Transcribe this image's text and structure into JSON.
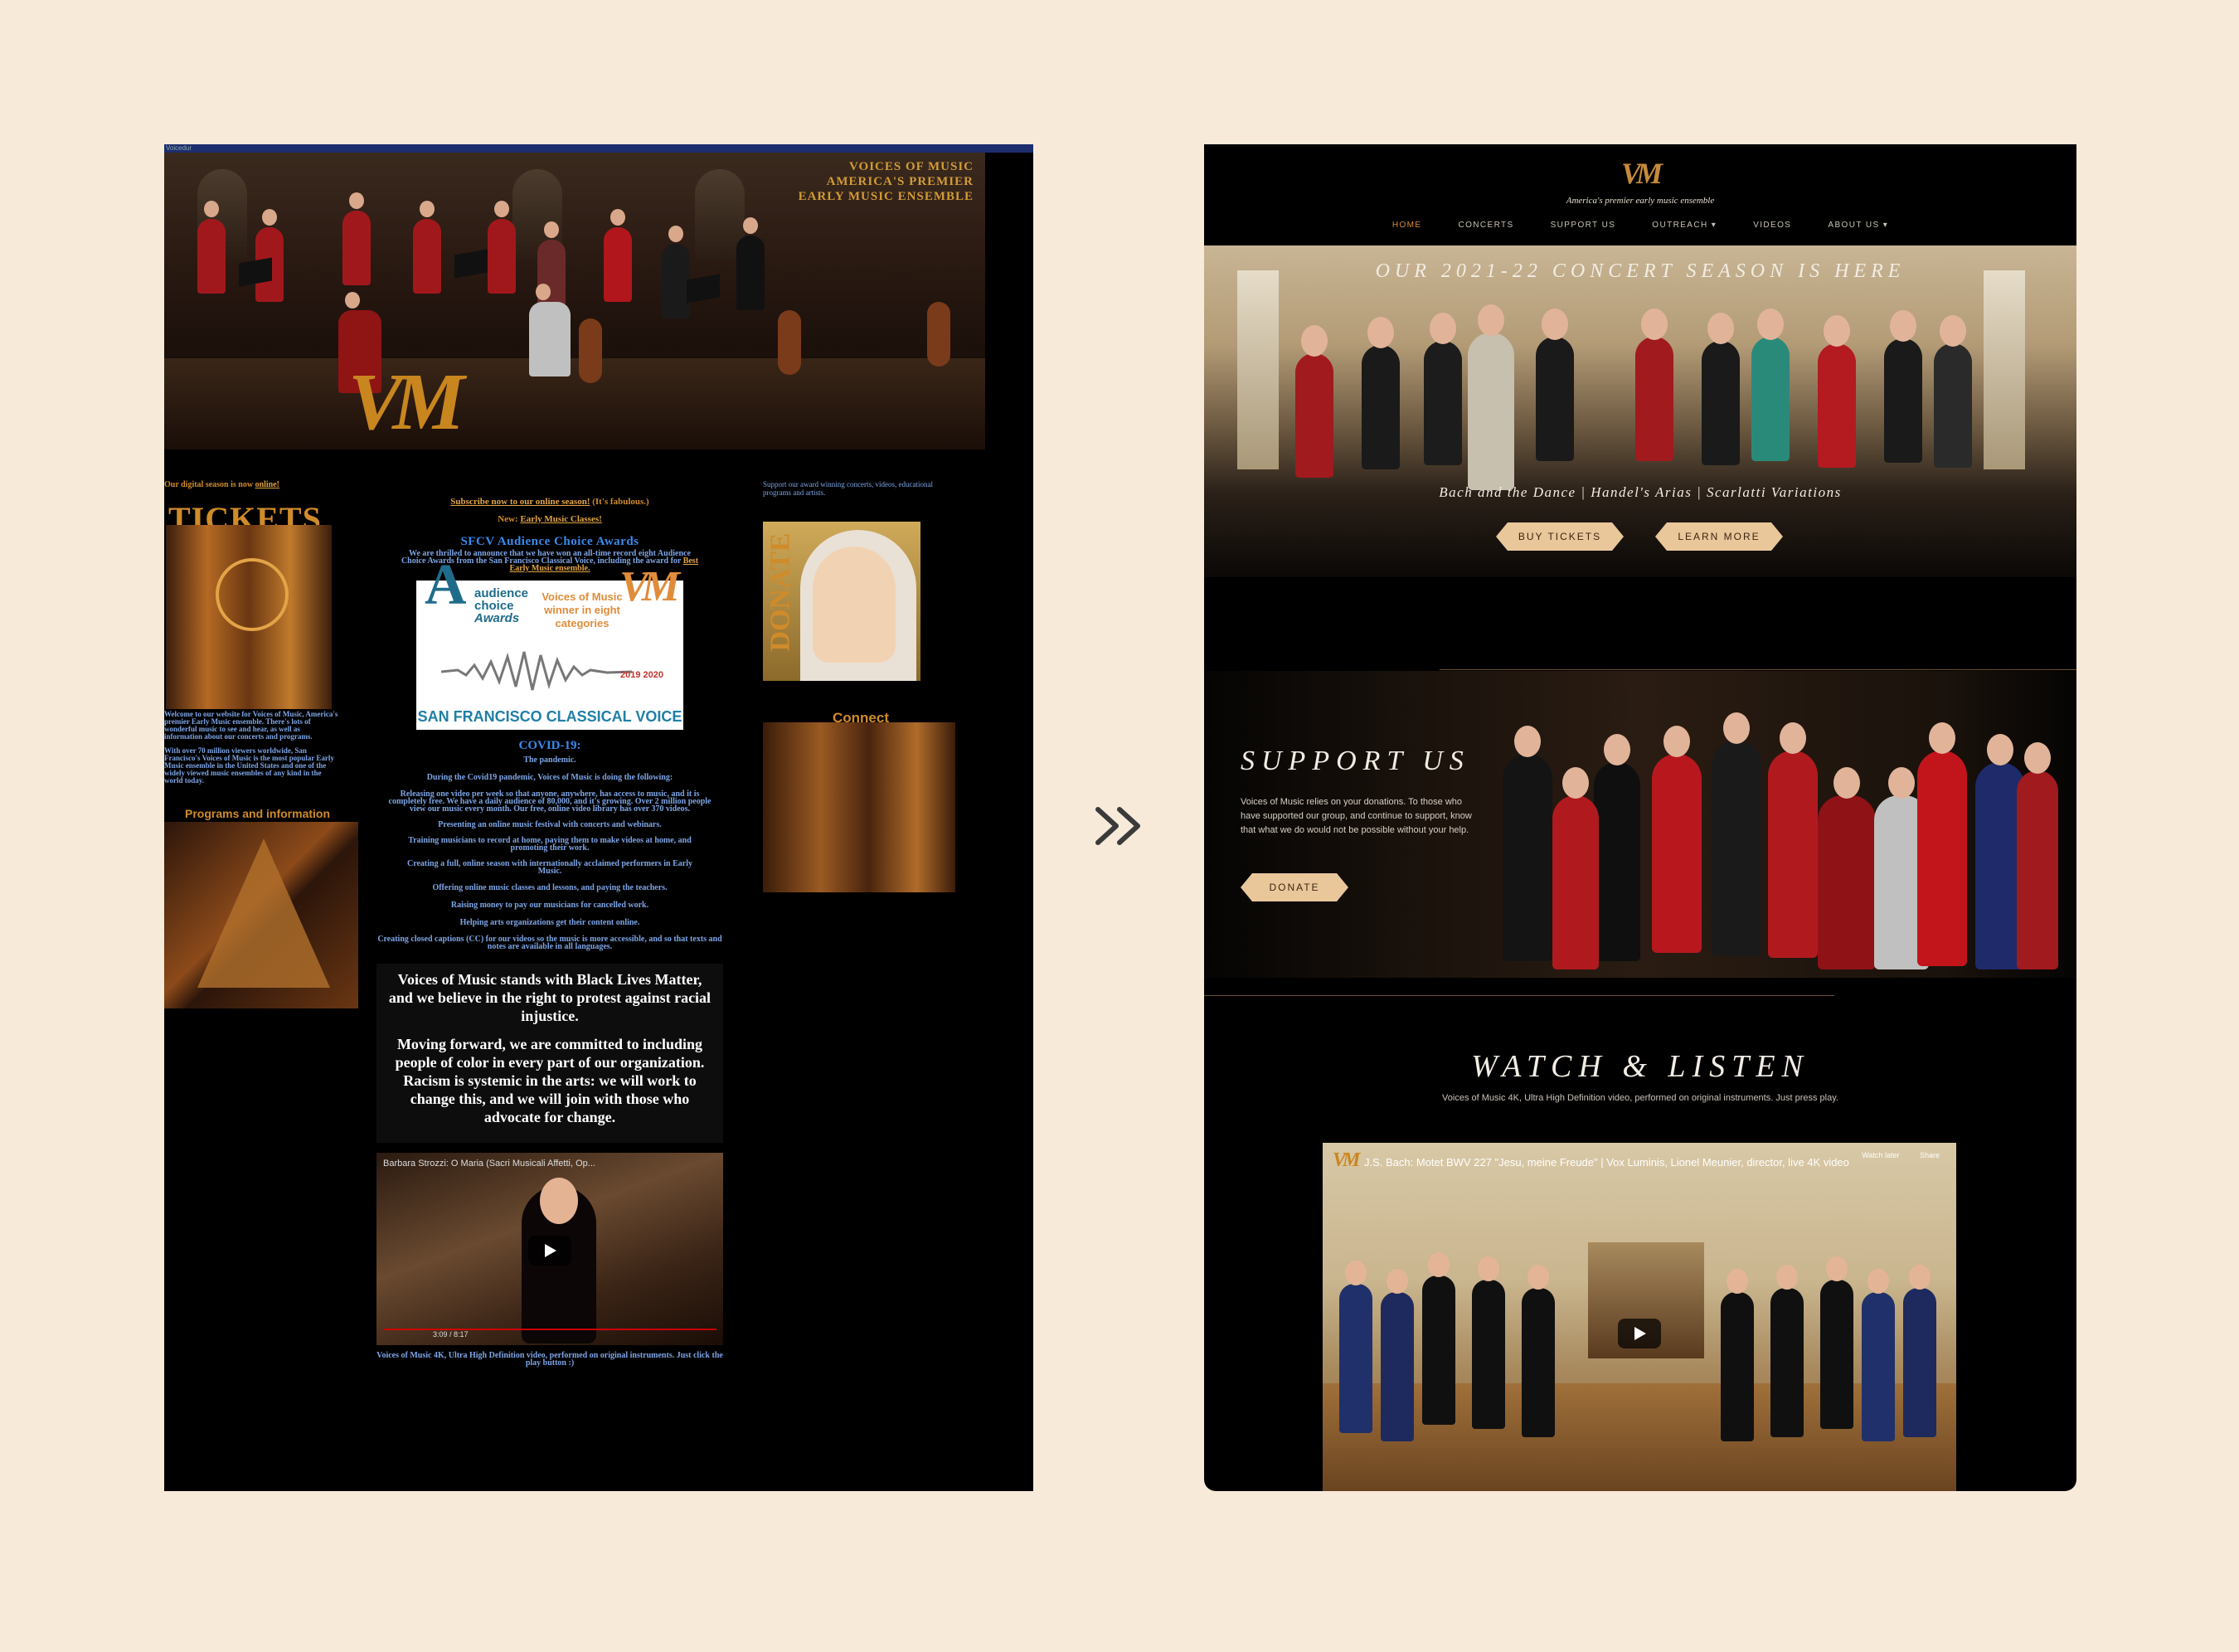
{
  "old_site": {
    "topbar_text": "Voicedur",
    "hero_title": [
      "VOICES OF MUSIC",
      "AMERICA'S PREMIER",
      "EARLY MUSIC ENSEMBLE"
    ],
    "logo_text": "VM",
    "digital_season": "Our digital season is now",
    "digital_season_link": "online!",
    "tickets_title": "TICKETS",
    "welcome": "Welcome to our website for Voices of Music, America's premier Early Music ensemble. There's lots of wonderful music to see and hear, as well as information about our concerts and programs.",
    "viewers": "With over 70 million viewers worldwide, San Francisco's Voices of Music is the most popular Early Music ensemble in the United States and one of the widely viewed music ensembles of any kind in the world today.",
    "programs_title": "Programs and information",
    "subscribe_link": "Subscribe now to our online season!",
    "subscribe_suffix": "(It's fabulous.)",
    "new_label": "New:",
    "new_link": "Early Music Classes!",
    "award_title": "SFCV Audience Choice Awards",
    "award_text": "We are thrilled to announce that we have won an all-time record eight Audience Choice Awards from the San Francisco Classical Voice, including the award for",
    "award_link": "Best Early Music ensemble.",
    "award_box": {
      "audience": "audience",
      "choice": "choice",
      "awards": "Awards",
      "winner": "Voices of Music winner in eight categories",
      "years": "2019 2020",
      "sfcv": "SAN FRANCISCO CLASSICAL VOICE"
    },
    "covid_title": "COVID-19:",
    "covid_lines": [
      "The pandemic.",
      "During the Covid19 pandemic, Voices of Music is doing the following:",
      "Releasing one video per week so that anyone, anywhere, has access to music, and it is completely free. We have a daily audience of 80,000, and it's growing. Over 2 million people view our music every month. Our free, online video library has over 370 videos.",
      "Presenting an online music festival with concerts and webinars.",
      "Training musicians to record at home, paying them to make videos at home, and promoting their work.",
      "Creating a full, online season with internationally acclaimed performers in Early Music.",
      "Offering online music classes and lessons, and paying the teachers.",
      "Raising money to pay our musicians for cancelled work.",
      "Helping arts organizations get their content online.",
      "Creating closed captions (CC) for our videos so the music is more accessible, and so that texts and notes are available in all languages."
    ],
    "blm_1": "Voices of Music stands with Black Lives Matter, and we believe in the right to protest against racial injustice.",
    "blm_2": "Moving forward, we are committed to including people of color in every part of our organization. Racism is systemic in the arts: we will work to change this, and we will join with those who advocate for change.",
    "video_title": "Barbara Strozzi: O Maria (Sacri Musicali Affetti, Op...",
    "video_time": "3:09 / 8:17",
    "video_caption": "Voices of Music 4K, Ultra High Definition video, performed on original instruments. Just click the play button :)",
    "support_text": "Support our award winning concerts, videos, educational programs and artists.",
    "donate_text": "DONATE",
    "connect_title": "Connect"
  },
  "new_site": {
    "logo_text": "VM",
    "tagline": "America's premier early music ensemble",
    "nav": [
      "HOME",
      "CONCERTS",
      "SUPPORT US",
      "OUTREACH ▾",
      "VIDEOS",
      "ABOUT US ▾"
    ],
    "hero_title": "OUR 2021-22 CONCERT SEASON IS HERE",
    "hero_sub": "Bach and the Dance | Handel's Arias | Scarlatti Variations",
    "buy_tickets": "BUY TICKETS",
    "learn_more": "LEARN MORE",
    "support_title": "SUPPORT US",
    "support_text": "Voices of Music relies on your donations. To those who have supported our group, and continue to support, know that what we do would not be possible without your help.",
    "donate": "DONATE",
    "watch_title": "WATCH & LISTEN",
    "watch_sub": "Voices of Music 4K, Ultra High Definition video, performed on original instruments. Just press play.",
    "video_title": "J.S. Bach: Motet BWV 227 \"Jesu, meine Freude\" | Vox Luminis, Lionel Meunier, director, live 4K video",
    "watch_later": "Watch later",
    "share": "Share"
  },
  "colors": {
    "page_bg": "#f8ead9",
    "gold": "#c9861f",
    "button_gold": "#e9c79a",
    "old_blue": "#7ea5e6"
  }
}
